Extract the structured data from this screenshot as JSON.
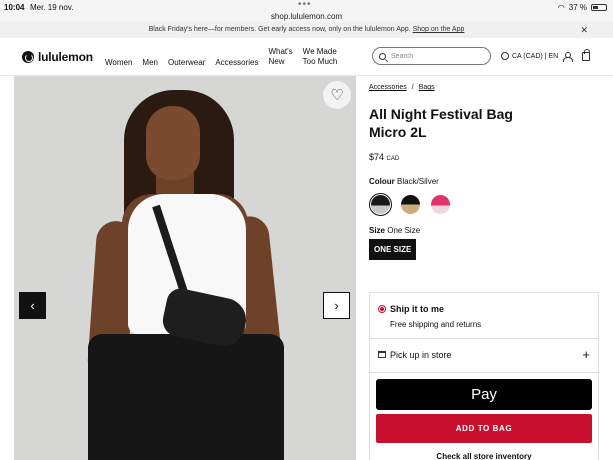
{
  "status_bar": {
    "time": "10:04",
    "date": "Mer. 19 nov.",
    "url": "shop.lululemon.com",
    "battery": "37 %"
  },
  "promo": {
    "text": "Black Friday's here—for members. Get early access now, only on the lululemon App.",
    "link": "Shop on the App"
  },
  "header": {
    "logo_text": "lululemon",
    "nav": [
      "Women",
      "Men",
      "Outerwear",
      "Accessories"
    ],
    "nav_two_line": [
      {
        "line1": "What's",
        "line2": "New"
      },
      {
        "line1": "We Made",
        "line2": "Too Much"
      }
    ],
    "search_placeholder": "Search",
    "locale": "CA (CAD) | EN"
  },
  "breadcrumb": [
    "Accessories",
    "Bags"
  ],
  "product": {
    "title": "All Night Festival Bag Micro 2L",
    "price": "$74",
    "currency": "CAD",
    "colour_label": "Colour",
    "colour_value": "Black/Silver",
    "swatches": [
      {
        "name": "Black/Silver",
        "color_top": "#1a1a1a",
        "color_bottom": "#c8c8c8",
        "selected": true
      },
      {
        "name": "Black/Gold",
        "color_top": "#111111",
        "color_bottom": "#c9ac7a",
        "selected": false
      },
      {
        "name": "Pink/White",
        "color_top": "#e0356a",
        "color_bottom": "#f3d3dc",
        "selected": false
      }
    ],
    "size_label": "Size",
    "size_value": "One Size",
    "size_button": "ONE SIZE"
  },
  "fulfilment": {
    "ship_title": "Ship it to me",
    "ship_sub": "Free shipping and returns",
    "pickup": "Pick up in store",
    "applepay": "Pay",
    "add_to_bag": "ADD TO BAG",
    "inventory_link": "Check all store inventory"
  },
  "colors": {
    "accent": "#c8102e",
    "black": "#111111"
  }
}
